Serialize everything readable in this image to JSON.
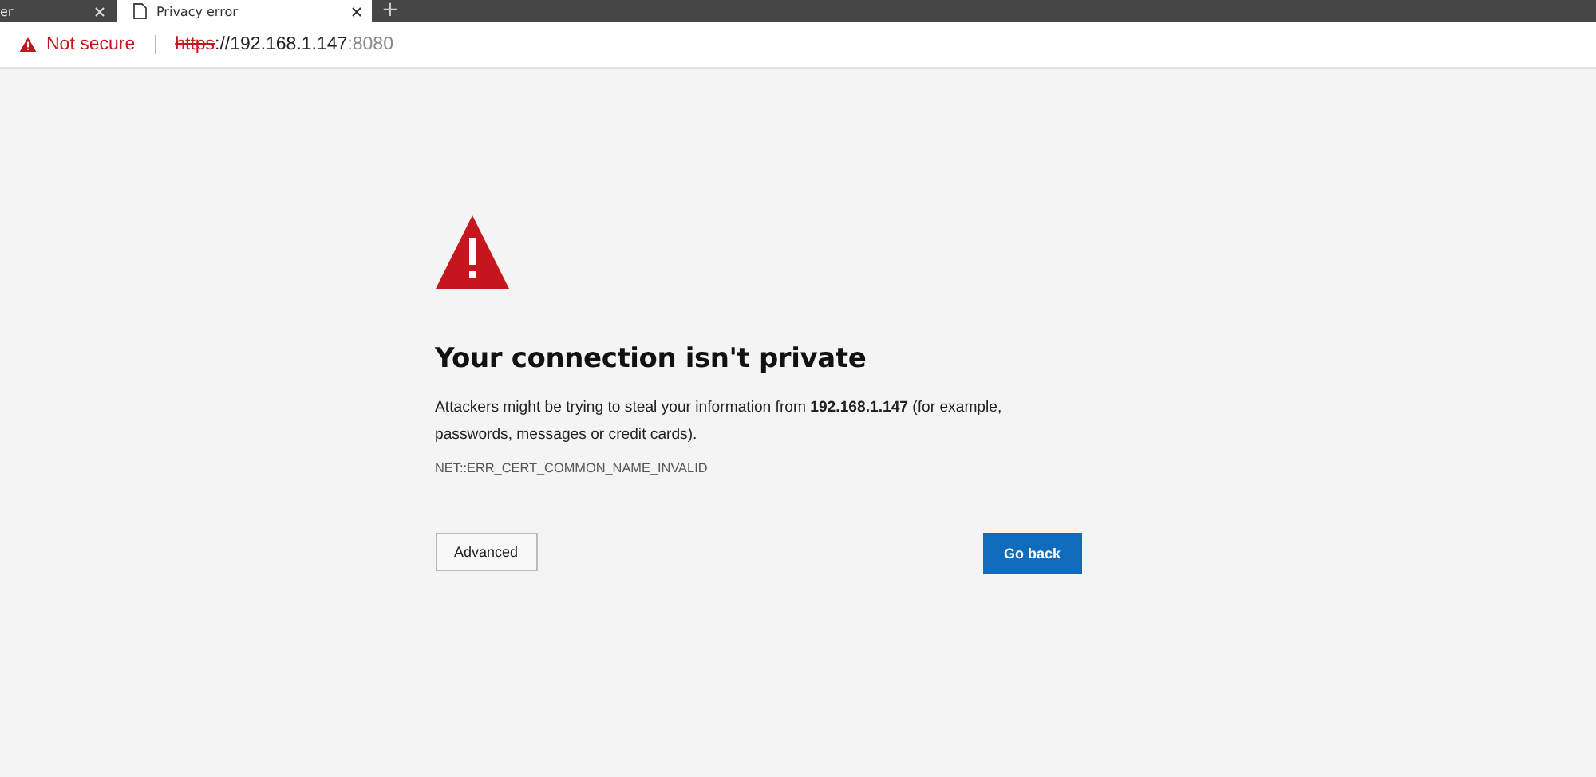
{
  "tabs": [
    {
      "label": "er",
      "selected": false
    },
    {
      "label": "Privacy error",
      "selected": true
    }
  ],
  "new_tab": "+",
  "address_bar": {
    "security": "Not secure",
    "scheme": "https",
    "host": "://192.168.1.147",
    "port": ":8080"
  },
  "error": {
    "title": "Your connection isn't private",
    "message": "Attackers might be trying to steal your information from **192.168.1.147** (for example, passwords, messages or credit cards).",
    "code": "NET::ERR_CERT_COMMON_NAME_INVALID",
    "buttons": [
      {
        "label": "Advanced",
        "kind": "secondary"
      },
      {
        "label": "Go back",
        "kind": "primary"
      }
    ]
  }
}
